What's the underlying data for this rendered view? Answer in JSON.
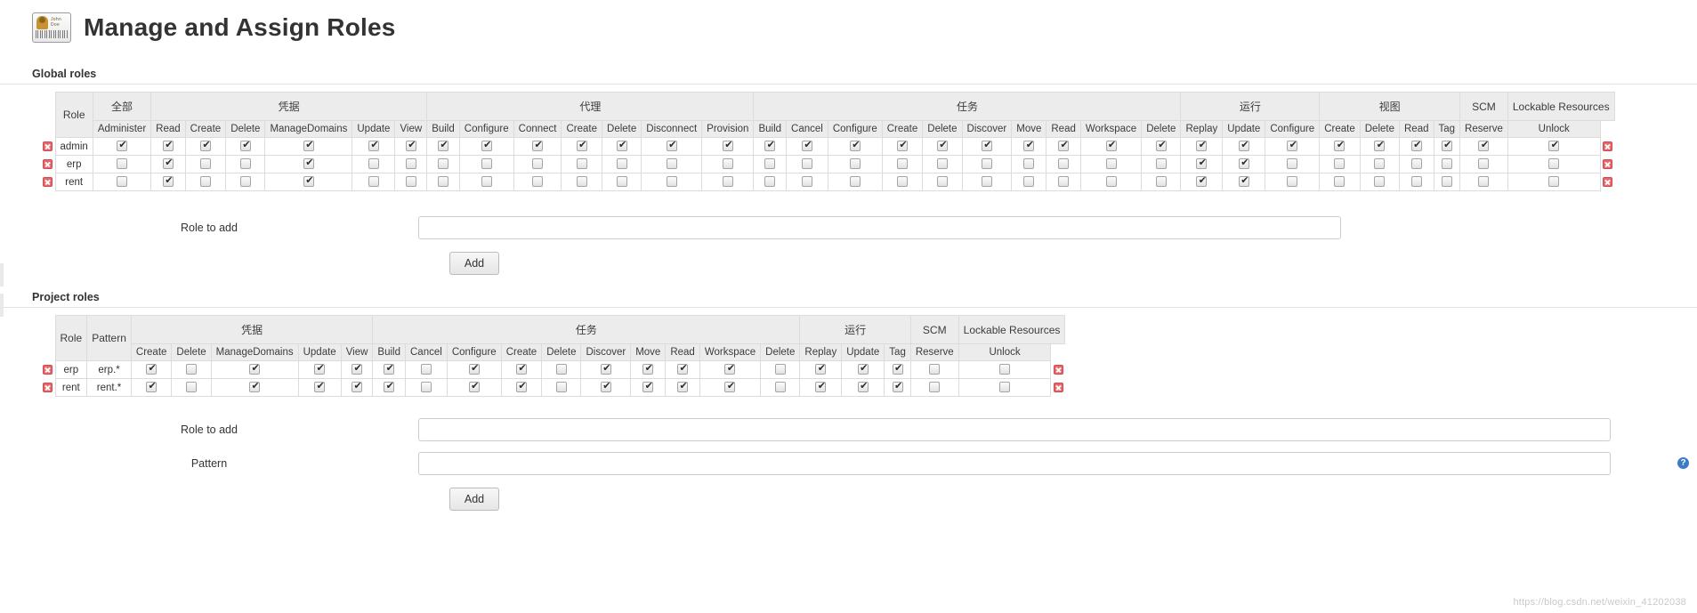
{
  "header": {
    "title": "Manage and Assign Roles",
    "icon": "id-card-icon",
    "badge_name": "John Doe"
  },
  "global": {
    "section_title": "Global roles",
    "role_col": "Role",
    "groups": [
      {
        "label": "全部",
        "span": 1
      },
      {
        "label": "凭据",
        "span": 6
      },
      {
        "label": "代理",
        "span": 7
      },
      {
        "label": "任务",
        "span": 10
      },
      {
        "label": "运行",
        "span": 3
      },
      {
        "label": "视图",
        "span": 4
      },
      {
        "label": "SCM",
        "span": 1
      },
      {
        "label": "Lockable Resources",
        "span": 2
      }
    ],
    "permissions": [
      "Administer",
      "Read",
      "Create",
      "Delete",
      "ManageDomains",
      "Update",
      "View",
      "Build",
      "Configure",
      "Connect",
      "Create",
      "Delete",
      "Disconnect",
      "Provision",
      "Build",
      "Cancel",
      "Configure",
      "Create",
      "Delete",
      "Discover",
      "Move",
      "Read",
      "Workspace",
      "Delete",
      "Replay",
      "Update",
      "Configure",
      "Create",
      "Delete",
      "Read",
      "Tag",
      "Reserve",
      "Unlock"
    ],
    "rows": [
      {
        "role": "admin",
        "checks": [
          true,
          true,
          true,
          true,
          true,
          true,
          true,
          true,
          true,
          true,
          true,
          true,
          true,
          true,
          true,
          true,
          true,
          true,
          true,
          true,
          true,
          true,
          true,
          true,
          true,
          true,
          true,
          true,
          true,
          true,
          true,
          true,
          true
        ]
      },
      {
        "role": "erp",
        "checks": [
          false,
          true,
          false,
          false,
          true,
          false,
          false,
          false,
          false,
          false,
          false,
          false,
          false,
          false,
          false,
          false,
          false,
          false,
          false,
          false,
          false,
          false,
          false,
          false,
          true,
          true,
          false,
          false,
          false,
          false,
          false,
          false,
          false
        ]
      },
      {
        "role": "rent",
        "checks": [
          false,
          true,
          false,
          false,
          true,
          false,
          false,
          false,
          false,
          false,
          false,
          false,
          false,
          false,
          false,
          false,
          false,
          false,
          false,
          false,
          false,
          false,
          false,
          false,
          true,
          true,
          false,
          false,
          false,
          false,
          false,
          false,
          false
        ]
      }
    ],
    "role_to_add_label": "Role to add",
    "role_to_add_value": "",
    "add_button": "Add"
  },
  "project": {
    "section_title": "Project roles",
    "role_col": "Role",
    "pattern_col": "Pattern",
    "groups": [
      {
        "label": "凭据",
        "span": 5
      },
      {
        "label": "任务",
        "span": 10
      },
      {
        "label": "运行",
        "span": 3
      },
      {
        "label": "SCM",
        "span": 1
      },
      {
        "label": "Lockable Resources",
        "span": 2
      }
    ],
    "permissions": [
      "Create",
      "Delete",
      "ManageDomains",
      "Update",
      "View",
      "Build",
      "Cancel",
      "Configure",
      "Create",
      "Delete",
      "Discover",
      "Move",
      "Read",
      "Workspace",
      "Delete",
      "Replay",
      "Update",
      "Tag",
      "Reserve",
      "Unlock"
    ],
    "rows": [
      {
        "role": "erp",
        "pattern": "erp.*",
        "checks": [
          true,
          false,
          true,
          true,
          true,
          true,
          false,
          true,
          true,
          false,
          true,
          true,
          true,
          true,
          false,
          true,
          true,
          true,
          false,
          false
        ]
      },
      {
        "role": "rent",
        "pattern": "rent.*",
        "checks": [
          true,
          false,
          true,
          true,
          true,
          true,
          false,
          true,
          true,
          false,
          true,
          true,
          true,
          true,
          false,
          true,
          true,
          true,
          false,
          false
        ]
      }
    ],
    "role_to_add_label": "Role to add",
    "role_to_add_value": "",
    "pattern_label": "Pattern",
    "pattern_value": "",
    "add_button": "Add",
    "help_icon": "help-icon"
  },
  "watermark": "https://blog.csdn.net/weixin_41202038"
}
